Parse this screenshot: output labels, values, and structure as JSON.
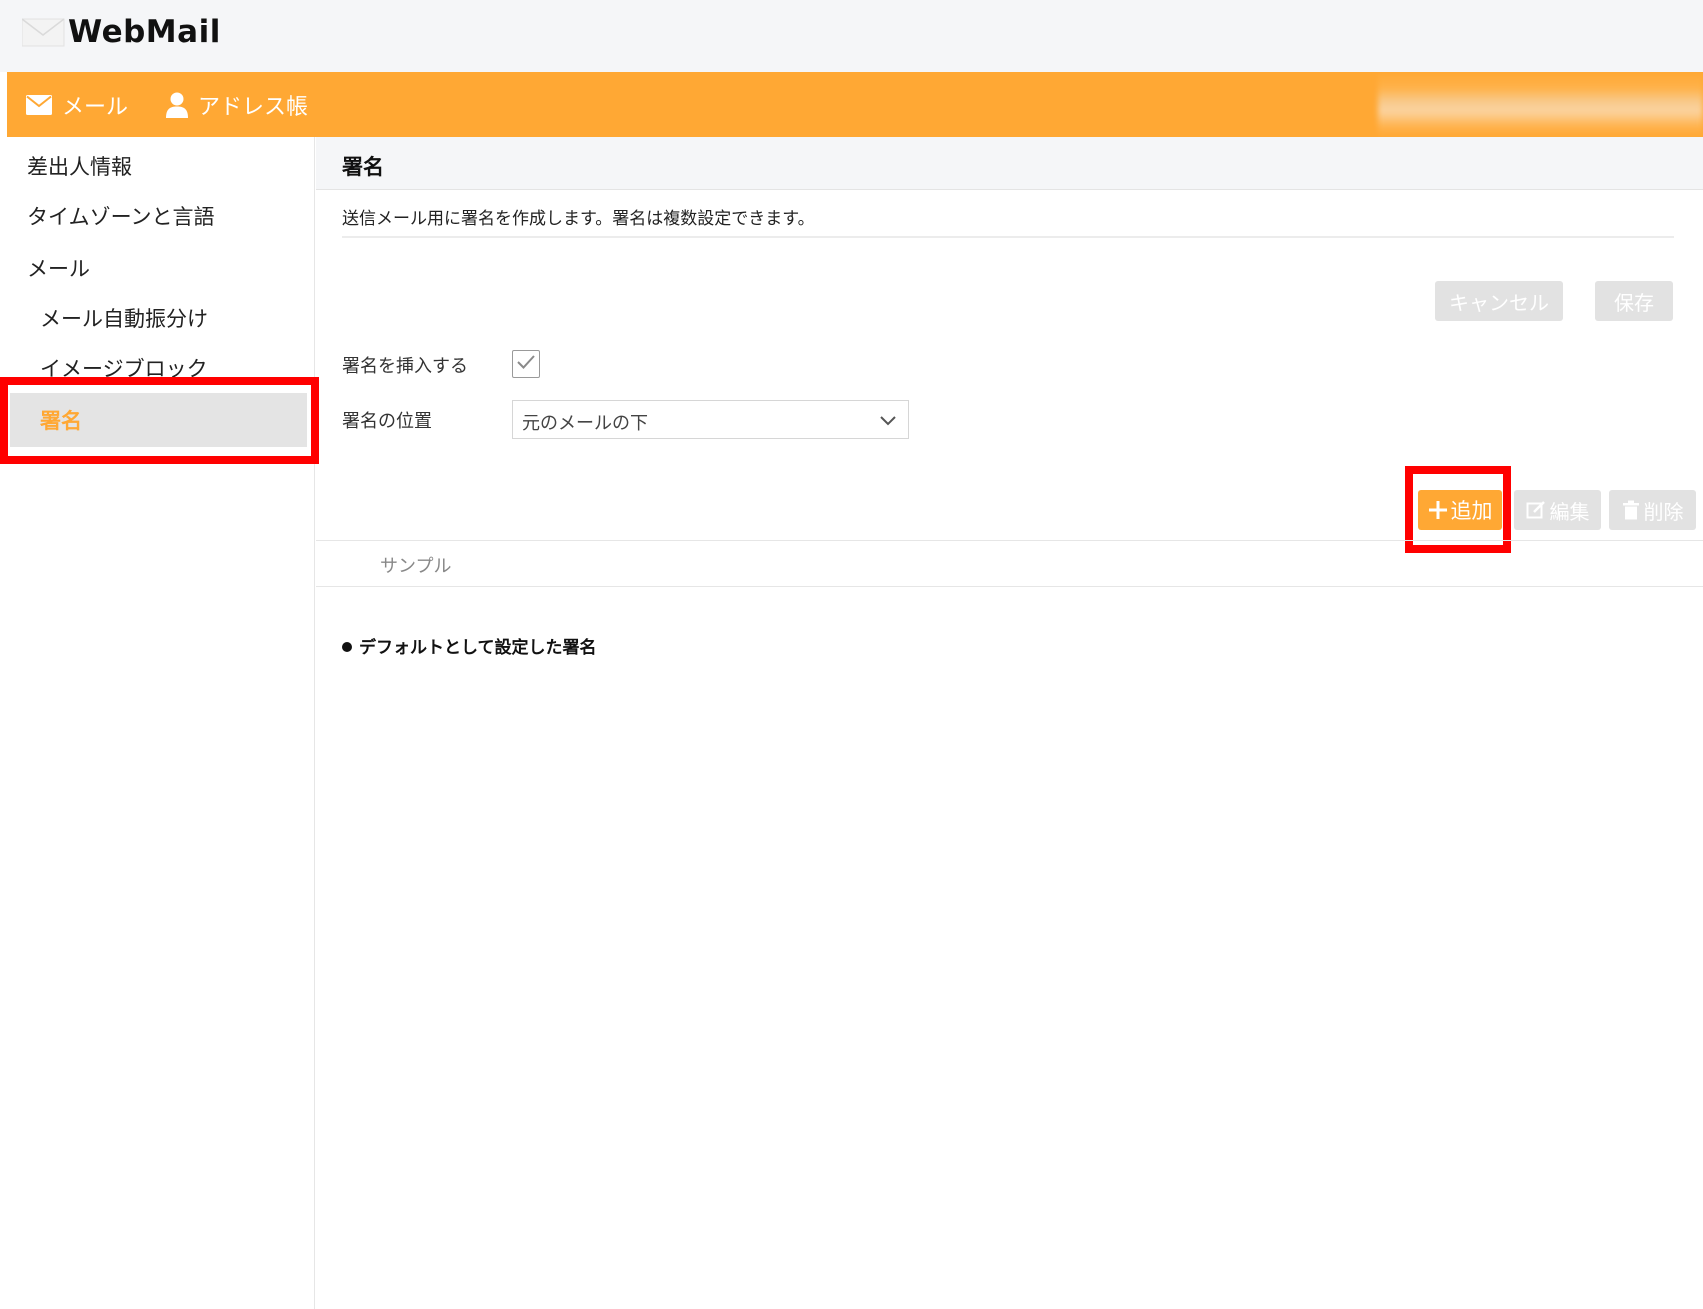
{
  "app": {
    "title": "WebMail"
  },
  "nav": {
    "items": [
      {
        "label": "メール",
        "icon": "envelope-icon"
      },
      {
        "label": "アドレス帳",
        "icon": "person-icon"
      }
    ]
  },
  "sidebar": {
    "items": [
      {
        "label": "差出人情報"
      },
      {
        "label": "タイムゾーンと言語"
      },
      {
        "label": "メール"
      },
      {
        "label": "メール自動振分け"
      },
      {
        "label": "イメージブロック"
      },
      {
        "label": "署名",
        "active": true
      }
    ]
  },
  "content": {
    "title": "署名",
    "description": "送信メール用に署名を作成します。署名は複数設定できます。",
    "buttons": {
      "cancel": "キャンセル",
      "save": "保存"
    },
    "form": {
      "insert_label": "署名を挿入する",
      "insert_checked": true,
      "position_label": "署名の位置",
      "position_value": "元のメールの下"
    },
    "list_actions": {
      "add": "追加",
      "edit": "編集",
      "delete": "削除"
    },
    "signatures": [
      {
        "name": "サンプル"
      }
    ],
    "default_note": "デフォルトとして設定した署名"
  },
  "colors": {
    "accent": "#ffa834",
    "highlight": "#ff0000",
    "disabled": "#e2e2e2",
    "active_bg": "#e4e4e4"
  }
}
